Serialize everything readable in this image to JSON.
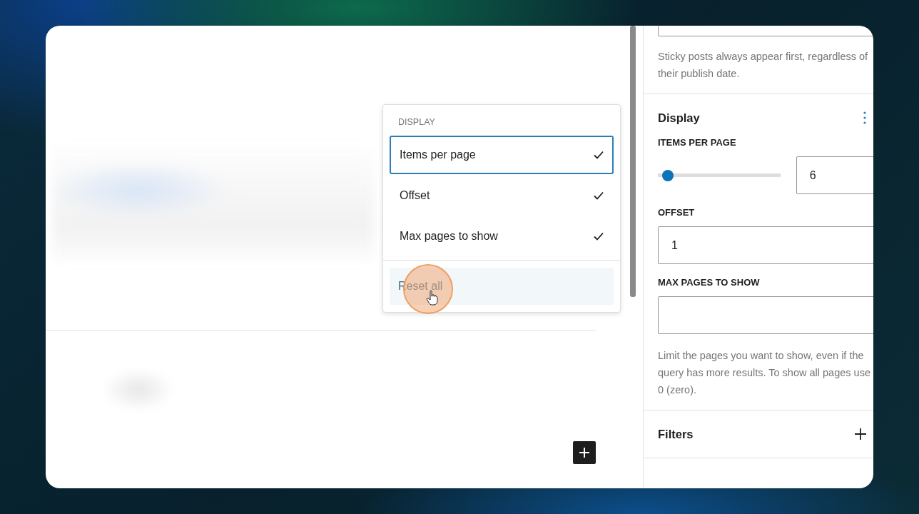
{
  "sidebar": {
    "top_help": "Sticky posts always appear first, regardless of their publish date.",
    "display_panel": {
      "title": "Display",
      "items_per_page": {
        "label": "ITEMS PER PAGE",
        "level": 0.04,
        "value": "6"
      },
      "offset": {
        "label": "OFFSET",
        "value": "1"
      },
      "max_pages": {
        "label": "MAX PAGES TO SHOW",
        "help": "Limit the pages you want to show, even if the query has more results. To show all pages use 0 (zero)."
      }
    },
    "filters_panel": {
      "title": "Filters"
    }
  },
  "dropdown_menu": {
    "heading": "DISPLAY",
    "items": [
      {
        "label": "Items per page",
        "checked": true,
        "selected": true
      },
      {
        "label": "Offset",
        "checked": true,
        "selected": false
      },
      {
        "label": "Max pages to show",
        "checked": true,
        "selected": false
      }
    ],
    "reset_label": "Reset all"
  }
}
